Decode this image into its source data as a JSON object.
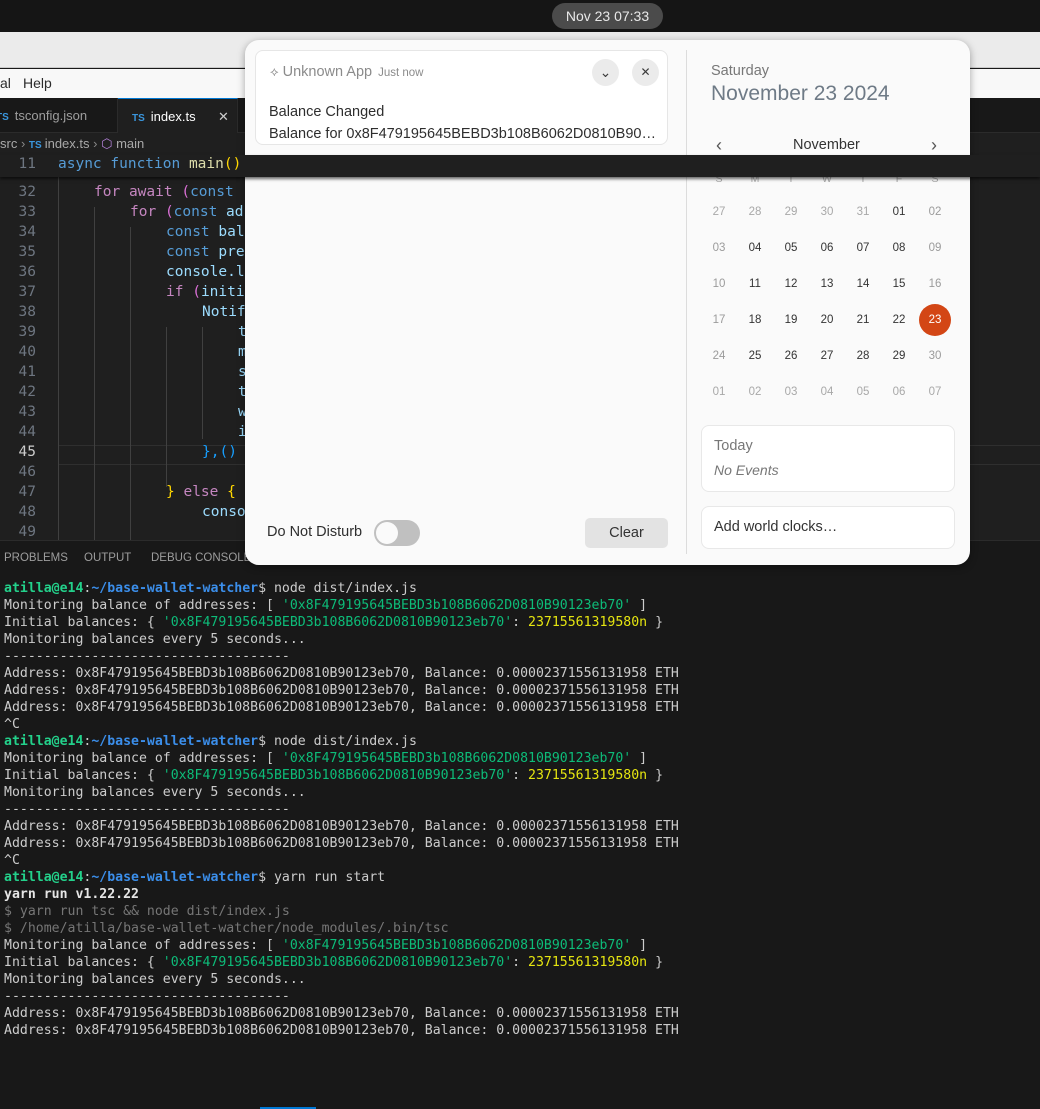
{
  "topbar": {
    "clock": "Nov 23  07:33"
  },
  "menubar": {
    "items": [
      "al",
      "Help"
    ]
  },
  "tabs": [
    {
      "label": "tsconfig.json",
      "active": false
    },
    {
      "label": "index.ts",
      "active": true
    }
  ],
  "breadcrumb": {
    "folder": "src",
    "file": "index.ts",
    "symbol": "main"
  },
  "editor": {
    "sticky": {
      "line": "11",
      "text": "async function main()"
    },
    "lines": [
      {
        "n": "32",
        "text": "for await (const"
      },
      {
        "n": "33",
        "text": "for (const ad"
      },
      {
        "n": "34",
        "text": "const bal"
      },
      {
        "n": "35",
        "text": "const pre"
      },
      {
        "n": "36",
        "text": "console.l"
      },
      {
        "n": "37",
        "text": "if (initi"
      },
      {
        "n": "38",
        "text": "Notif"
      },
      {
        "n": "39",
        "text": "t"
      },
      {
        "n": "40",
        "text": "m"
      },
      {
        "n": "41",
        "text": "s"
      },
      {
        "n": "42",
        "text": "t"
      },
      {
        "n": "43",
        "text": "w"
      },
      {
        "n": "44",
        "text": "i"
      },
      {
        "n": "45",
        "text": "},()"
      },
      {
        "n": "46",
        "text": ""
      },
      {
        "n": "47",
        "text": "} else {"
      },
      {
        "n": "48",
        "text": "conso"
      },
      {
        "n": "49",
        "text": ""
      }
    ],
    "current_line": "45"
  },
  "panel": {
    "tabs": [
      "PROBLEMS",
      "OUTPUT",
      "DEBUG CONSOLE"
    ]
  },
  "terminal": {
    "user": "atilla@e14",
    "path": "~/base-wallet-watcher",
    "address": "0x8F479195645BEBD3b108B6062D0810B90123eb70",
    "initial_balance": "23715561319580n",
    "balance_eth": "0.00002371556131958",
    "lines": [
      {
        "type": "prompt",
        "cmd": "node dist/index.js"
      },
      {
        "type": "monitoring"
      },
      {
        "type": "initial"
      },
      {
        "type": "plain",
        "text": "Monitoring balances every 5 seconds..."
      },
      {
        "type": "plain",
        "text": "------------------------------------"
      },
      {
        "type": "balance"
      },
      {
        "type": "balance"
      },
      {
        "type": "balance"
      },
      {
        "type": "plain",
        "text": "^C"
      },
      {
        "type": "prompt",
        "cmd": "node dist/index.js"
      },
      {
        "type": "monitoring"
      },
      {
        "type": "initial"
      },
      {
        "type": "plain",
        "text": "Monitoring balances every 5 seconds..."
      },
      {
        "type": "plain",
        "text": "------------------------------------"
      },
      {
        "type": "balance"
      },
      {
        "type": "balance"
      },
      {
        "type": "plain",
        "text": "^C"
      },
      {
        "type": "prompt",
        "cmd": "yarn run start"
      },
      {
        "type": "bold",
        "text": "yarn run v1.22.22"
      },
      {
        "type": "dim",
        "text": "$ yarn run tsc && node dist/index.js"
      },
      {
        "type": "dim",
        "text": "$ /home/atilla/base-wallet-watcher/node_modules/.bin/tsc"
      },
      {
        "type": "monitoring"
      },
      {
        "type": "initial"
      },
      {
        "type": "plain",
        "text": "Monitoring balances every 5 seconds..."
      },
      {
        "type": "plain",
        "text": "------------------------------------"
      },
      {
        "type": "balance"
      },
      {
        "type": "balance"
      }
    ]
  },
  "notification": {
    "app": "Unknown App",
    "time": "Just now",
    "title": "Balance Changed",
    "body": "Balance for 0x8F479195645BEBD3b108B6062D0810B90…"
  },
  "dnd": {
    "label": "Do Not Disturb",
    "enabled": false
  },
  "clear_label": "Clear",
  "calendar": {
    "weekday": "Saturday",
    "full_date": "November 23 2024",
    "month": "November",
    "day_headers": [
      "S",
      "M",
      "T",
      "W",
      "T",
      "F",
      "S"
    ],
    "weeks": [
      [
        "27",
        "28",
        "29",
        "30",
        "31",
        "01",
        "02"
      ],
      [
        "03",
        "04",
        "05",
        "06",
        "07",
        "08",
        "09"
      ],
      [
        "10",
        "11",
        "12",
        "13",
        "14",
        "15",
        "16"
      ],
      [
        "17",
        "18",
        "19",
        "20",
        "21",
        "22",
        "23"
      ],
      [
        "24",
        "25",
        "26",
        "27",
        "28",
        "29",
        "30"
      ],
      [
        "01",
        "02",
        "03",
        "04",
        "05",
        "06",
        "07"
      ]
    ],
    "today": "23",
    "accent": "#d34615"
  },
  "events": {
    "label": "Today",
    "empty": "No Events"
  },
  "world_clocks": {
    "label": "Add world clocks…"
  }
}
